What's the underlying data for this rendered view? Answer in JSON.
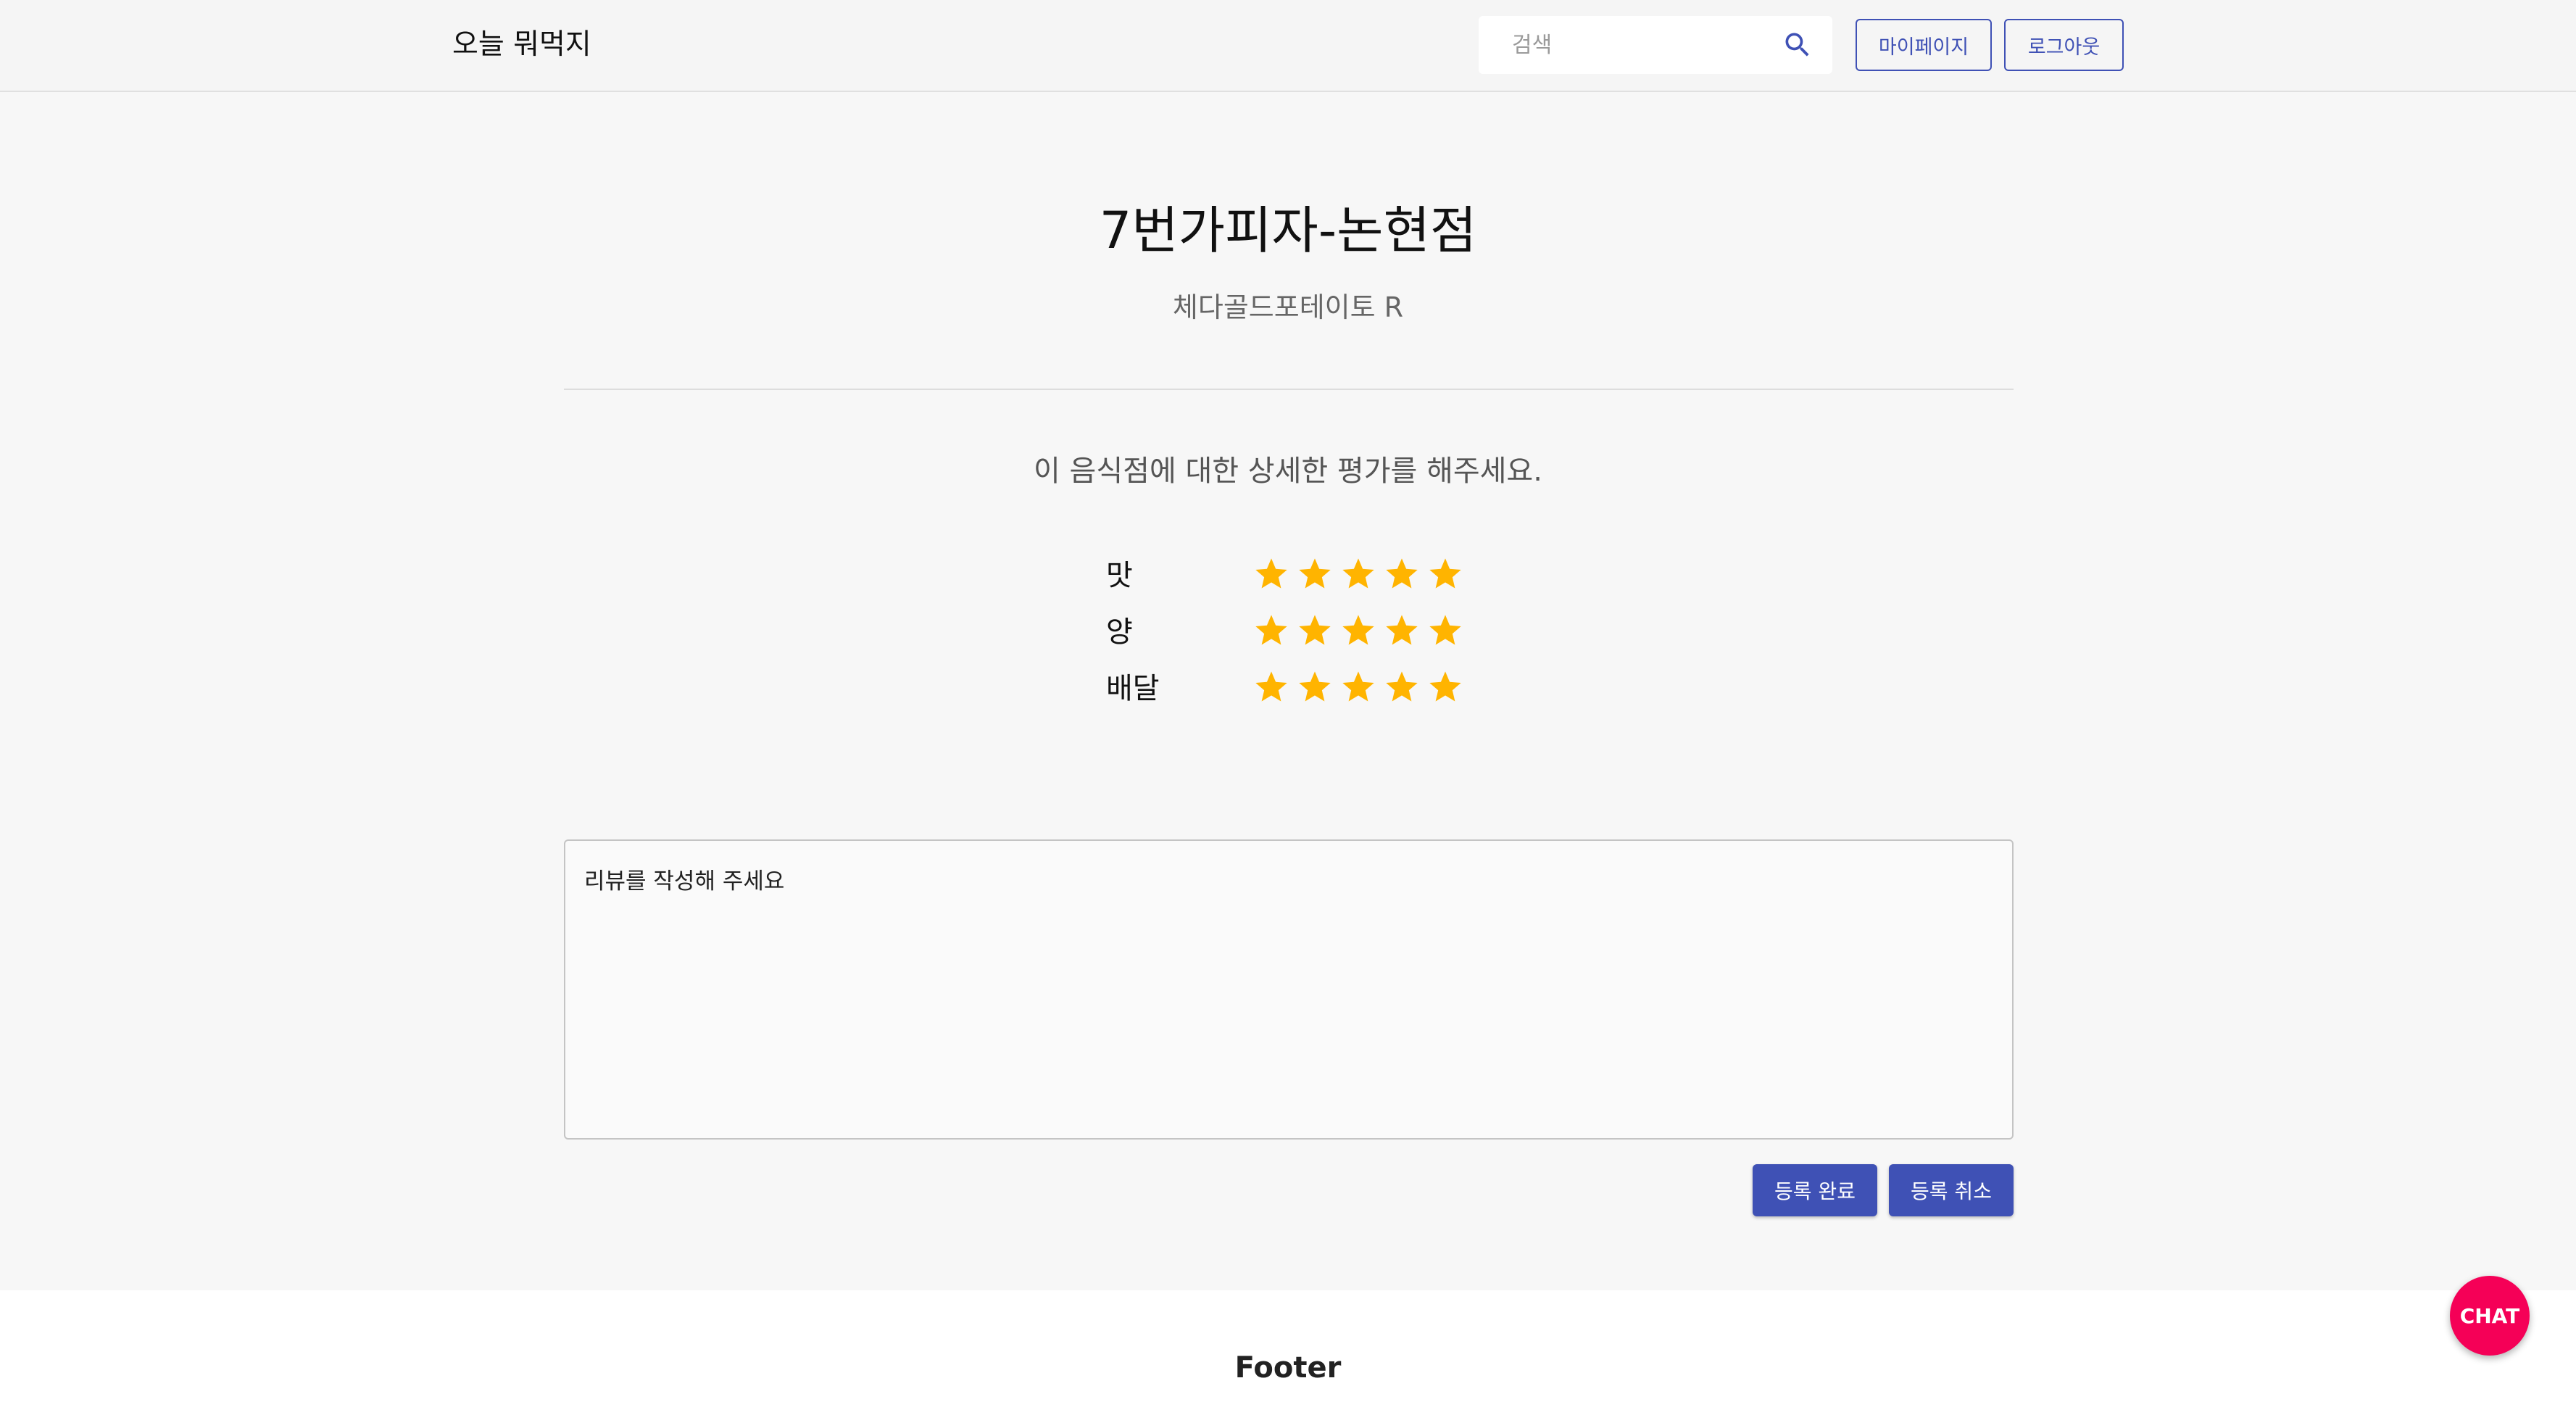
{
  "header": {
    "brand": "오늘 뭐먹지",
    "search": {
      "placeholder": "검색",
      "icon": "search-icon"
    },
    "mypage_label": "마이페이지",
    "logout_label": "로그아웃"
  },
  "main": {
    "restaurant_name": "7번가피자-논현점",
    "menu_name": "체다골드포테이토 R",
    "prompt": "이 음식점에 대한 상세한 평가를 해주세요.",
    "ratings": [
      {
        "label": "맛",
        "value": 5,
        "max": 5
      },
      {
        "label": "양",
        "value": 5,
        "max": 5
      },
      {
        "label": "배달",
        "value": 5,
        "max": 5
      }
    ],
    "review": {
      "placeholder": "리뷰를 작성해 주세요",
      "value": ""
    },
    "submit_label": "등록 완료",
    "cancel_label": "등록 취소"
  },
  "footer": {
    "title": "Footer"
  },
  "chat": {
    "label": "CHAT"
  },
  "colors": {
    "primary": "#3f51b5",
    "star": "#ffb400",
    "chat": "#f50057"
  }
}
